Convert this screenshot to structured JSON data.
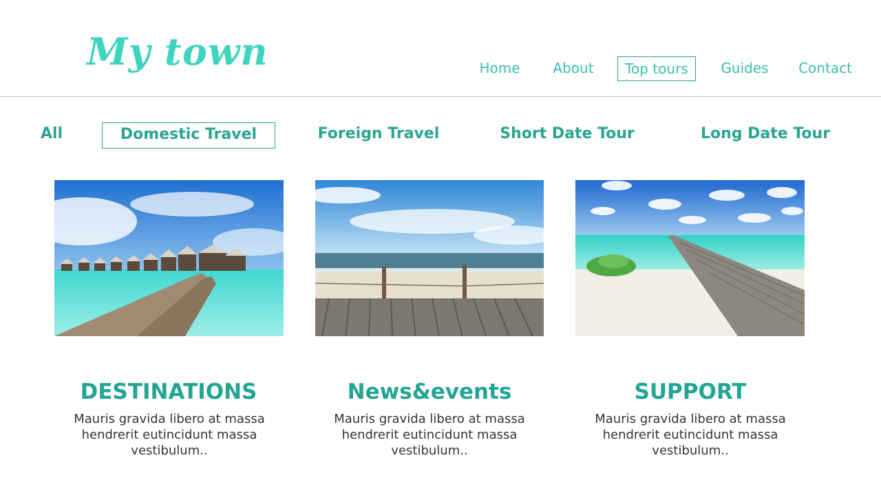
{
  "brand": {
    "logo_text": "My town",
    "color": "#3fd4bf"
  },
  "nav": {
    "items": [
      {
        "label": "Home"
      },
      {
        "label": "About"
      },
      {
        "label": "Top tours",
        "active": true
      },
      {
        "label": "Guides"
      },
      {
        "label": "Contact"
      }
    ]
  },
  "filters": {
    "items": [
      {
        "label": "All"
      },
      {
        "label": "Domestic Travel",
        "active": true
      },
      {
        "label": "Foreign Travel"
      },
      {
        "label": "Short Date Tour"
      },
      {
        "label": "Long Date Tour"
      }
    ]
  },
  "cards": [
    {
      "title": "DESTINATIONS",
      "text": "Mauris gravida libero at massa hendrerit eutincidunt massa vestibulum.."
    },
    {
      "title": "News&events",
      "text": "Mauris gravida libero at massa hendrerit eutincidunt massa vestibulum.."
    },
    {
      "title": "SUPPORT",
      "text": "Mauris gravida libero at massa hendrerit eutincidunt massa vestibulum.."
    }
  ],
  "colors": {
    "accent": "#2aa590",
    "nav_text": "#3bbfac",
    "body_text": "#333333",
    "rule": "#bdbdbd"
  }
}
